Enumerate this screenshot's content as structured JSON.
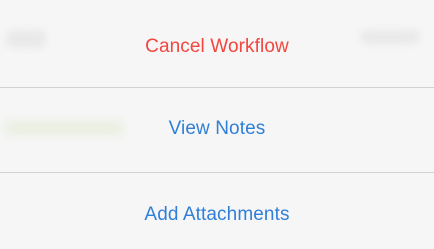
{
  "action_sheet": {
    "actions": [
      {
        "label": "Cancel Workflow",
        "style": "destructive",
        "color": "#f2463f"
      },
      {
        "label": "View Notes",
        "style": "default",
        "color": "#2f7fd8"
      },
      {
        "label": "Add Attachments",
        "style": "default",
        "color": "#2f7fd8"
      }
    ]
  }
}
